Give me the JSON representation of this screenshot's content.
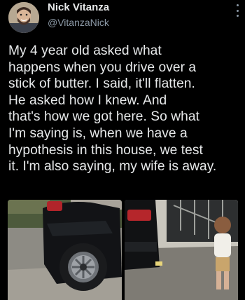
{
  "tweet": {
    "display_name": "Nick Vitanza",
    "handle": "@VitanzaNick",
    "text": "My 4 year old asked what\nhappens when you drive over a\nstick of butter. I said, it'll flatten.\nHe asked how I knew. And\nthat's how we got here. So what\nI'm saying is, when we have a\nhypothesis in this house, we test\nit. I'm also saying, my wife is away."
  },
  "icons": {
    "more": "more-vertical-icon",
    "avatar": "profile-photo"
  },
  "colors": {
    "background": "#000000",
    "text": "#e7e9ea",
    "secondary_text": "#8b98a5"
  }
}
